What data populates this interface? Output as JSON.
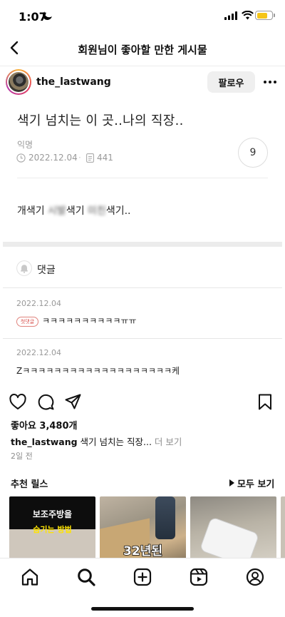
{
  "status_bar": {
    "time": "1:07",
    "icons": [
      "moon-icon",
      "signal-icon",
      "wifi-icon",
      "battery-icon"
    ],
    "battery_color": "#f5c518"
  },
  "header": {
    "title": "회원님이 좋아할 만한 게시물",
    "back_icon": "chevron-left-icon"
  },
  "profile": {
    "username": "the_lastwang",
    "follow_label": "팔로우",
    "more_icon": "more-horizontal-icon",
    "ring_colors": [
      "#f9b233",
      "#e4405f",
      "#b83aa8"
    ]
  },
  "post": {
    "title": "색기 넘치는 이 곳..나의 직장..",
    "author": "익명",
    "date": "2022.12.04",
    "views": "441",
    "comment_count": "9",
    "body_prefix": "개색기 ",
    "body_blur_1": "시발",
    "body_mid": "색기 ",
    "body_blur_2": "미친",
    "body_suffix": "색기.."
  },
  "comments": {
    "heading": "댓글",
    "items": [
      {
        "date": "2022.12.04",
        "badge": "첫댓글",
        "text": "ㅋㅋㅋㅋㅋㅋㅋㅋㅋㅋㅠㅠ"
      },
      {
        "date": "2022.12.04",
        "text": "Zㅋㅋㅋㅋㅋㅋㅋㅋㅋㅋㅋㅋㅋㅋㅋㅋㅋㅋㅋ케"
      }
    ]
  },
  "actions": {
    "likes": "좋아요 3,480개",
    "caption_user": "the_lastwang",
    "caption_text": " 색기 넘치는 직장...",
    "caption_more": " 더 보기",
    "time_ago": "2일 전"
  },
  "reels": {
    "title": "추천 릴스",
    "see_all": "모두 보기",
    "items": [
      {
        "line1": "보조주방을",
        "line2": "숨기는 방법"
      },
      {
        "line1": "32년된"
      },
      {},
      {}
    ]
  },
  "bottom_nav": {
    "items": [
      "home-icon",
      "search-icon",
      "create-icon",
      "reels-icon",
      "profile-icon"
    ],
    "active": "search"
  }
}
